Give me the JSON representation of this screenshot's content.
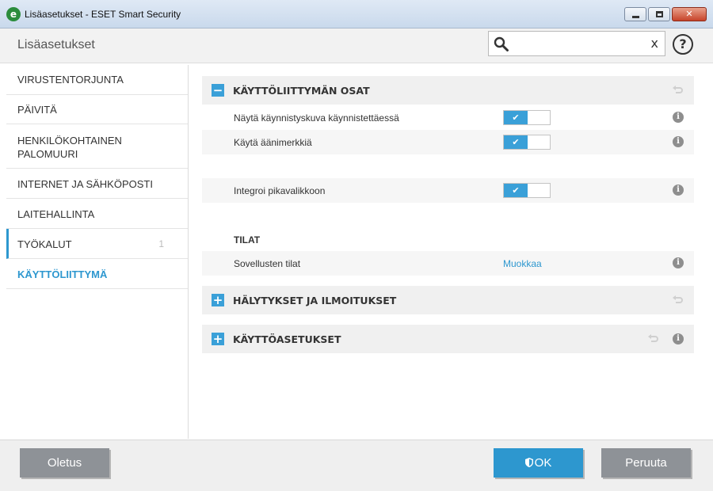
{
  "window": {
    "title": "Lisäasetukset - ESET Smart Security",
    "app_icon_letter": "e"
  },
  "header": {
    "title": "Lisäasetukset",
    "search_placeholder": "",
    "search_clear": "x",
    "help": "?"
  },
  "sidebar": {
    "items": [
      {
        "label": "VIRUSTENTORJUNTA"
      },
      {
        "label": "PÄIVITÄ"
      },
      {
        "label": "HENKILÖKOHTAINEN PALOMUURI"
      },
      {
        "label": "INTERNET JA SÄHKÖPOSTI"
      },
      {
        "label": "LAITEHALLINTA"
      },
      {
        "label": "TYÖKALUT",
        "count": "1"
      },
      {
        "label": "KÄYTTÖLIITTYMÄ"
      }
    ]
  },
  "sections": {
    "ui_elements": {
      "title": "KÄYTTÖLIITTYMÄN OSAT",
      "expander": "−",
      "rows": [
        {
          "label": "Näytä käynnistyskuva käynnistettäessä",
          "enabled": true
        },
        {
          "label": "Käytä äänimerkkiä",
          "enabled": true
        },
        {
          "label": "Integroi pikavalikkoon",
          "enabled": true
        }
      ],
      "states_heading": "TILAT",
      "states_row": {
        "label": "Sovellusten tilat",
        "link": "Muokkaa"
      }
    },
    "alerts": {
      "title": "HÄLYTYKSET JA ILMOITUKSET",
      "expander": "+"
    },
    "access": {
      "title": "KÄYTTÖASETUKSET",
      "expander": "+"
    }
  },
  "footer": {
    "default_label": "Oletus",
    "ok_label": "OK",
    "cancel_label": "Peruuta"
  },
  "icons": {
    "toggle_check": "✔",
    "info": "i"
  },
  "colors": {
    "accent": "#2d97cf",
    "toggle_on": "#3aa0d8",
    "button_gray": "#8e9297"
  }
}
